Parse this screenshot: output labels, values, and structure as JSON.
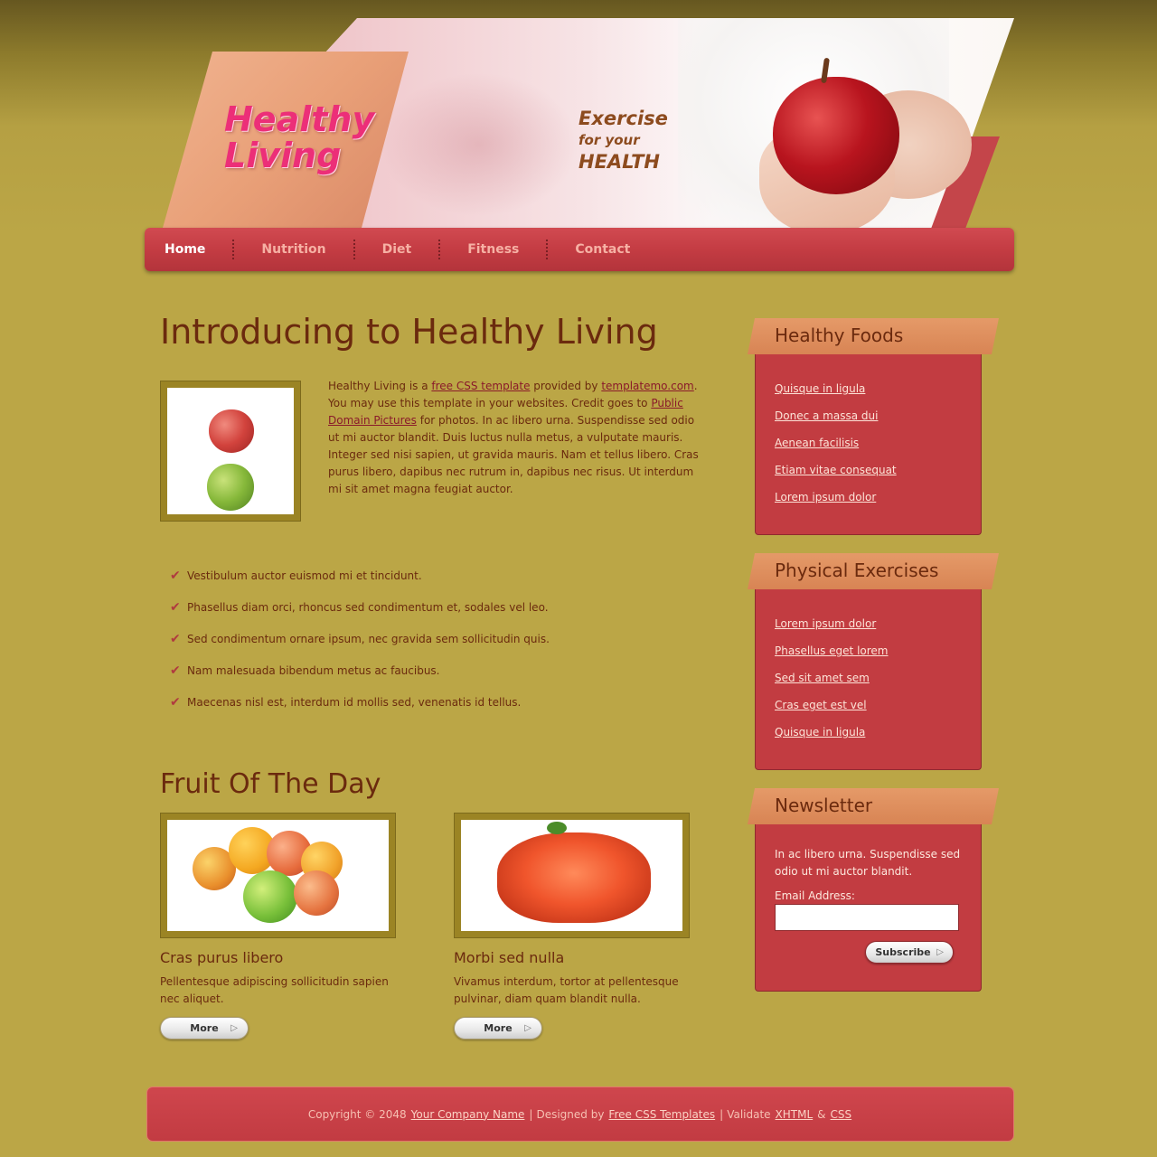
{
  "header": {
    "logo_line1": "Healthy",
    "logo_line2": "Living",
    "slogan_line1": "Exercise",
    "slogan_line2": "for your",
    "slogan_line3": "HEALTH"
  },
  "nav": {
    "items": [
      "Home",
      "Nutrition",
      "Diet",
      "Fitness",
      "Contact"
    ],
    "active": "Home"
  },
  "main": {
    "title": "Introducing to Healthy Living",
    "intro": {
      "p1": "Healthy Living is a ",
      "link1": "free CSS template",
      "p2": " provided by ",
      "link2": "templatemo.com",
      "p3": ". You may use this template in your websites. Credit goes to ",
      "link3": "Public Domain Pictures",
      "p4": " for photos. In ac libero urna. Suspendisse sed odio ut mi auctor blandit. Duis luctus nulla metus, a vulputate mauris. Integer sed nisi sapien, ut gravida mauris. Nam et tellus libero. Cras purus libero, dapibus nec rutrum in, dapibus nec risus. Ut interdum mi sit amet magna feugiat auctor."
    },
    "checklist": [
      "Vestibulum auctor euismod mi et tincidunt.",
      "Phasellus diam orci, rhoncus sed condimentum et, sodales vel leo.",
      "Sed condimentum ornare ipsum, nec gravida sem sollicitudin quis.",
      "Nam malesuada bibendum metus ac faucibus.",
      "Maecenas nisl est, interdum id mollis sed, venenatis id tellus."
    ],
    "fruit_title": "Fruit Of The Day",
    "fruits": [
      {
        "name": "Cras purus libero",
        "desc": "Pellentesque adipiscing sollicitudin sapien nec aliquet.",
        "button": "More"
      },
      {
        "name": "Morbi sed nulla",
        "desc": "Vivamus interdum, tortor at pellentesque pulvinar, diam quam blandit nulla.",
        "button": "More"
      }
    ]
  },
  "sidebar": {
    "healthy_foods": {
      "title": "Healthy Foods",
      "links": [
        "Quisque in ligula",
        "Donec a massa dui",
        "Aenean facilisis",
        "Etiam vitae consequat",
        "Lorem ipsum dolor"
      ]
    },
    "physical_exercises": {
      "title": "Physical Exercises",
      "links": [
        "Lorem ipsum dolor",
        "Phasellus eget lorem",
        "Sed sit amet sem",
        "Cras eget est vel",
        "Quisque in ligula"
      ]
    },
    "newsletter": {
      "title": "Newsletter",
      "text": "In ac libero urna. Suspendisse sed odio ut mi auctor blandit.",
      "email_label": "Email Address:",
      "email_value": "",
      "button": "Subscribe"
    }
  },
  "footer": {
    "copyright": "Copyright © 2048",
    "company": "Your Company Name",
    "sep1": "|",
    "designed_by": "Designed by",
    "designer": "Free CSS Templates",
    "sep2": "|",
    "validate": "Validate",
    "xhtml": "XHTML",
    "amp": "&",
    "css": "CSS"
  },
  "colors": {
    "background": "#bba646",
    "accent_red": "#c23c41",
    "tab_orange": "#e59a68",
    "text_brown": "#6b2a0e",
    "logo_pink": "#ec2f78"
  },
  "icons": {
    "check": "checkmark-icon",
    "button_arrow": "play-arrow-icon"
  }
}
